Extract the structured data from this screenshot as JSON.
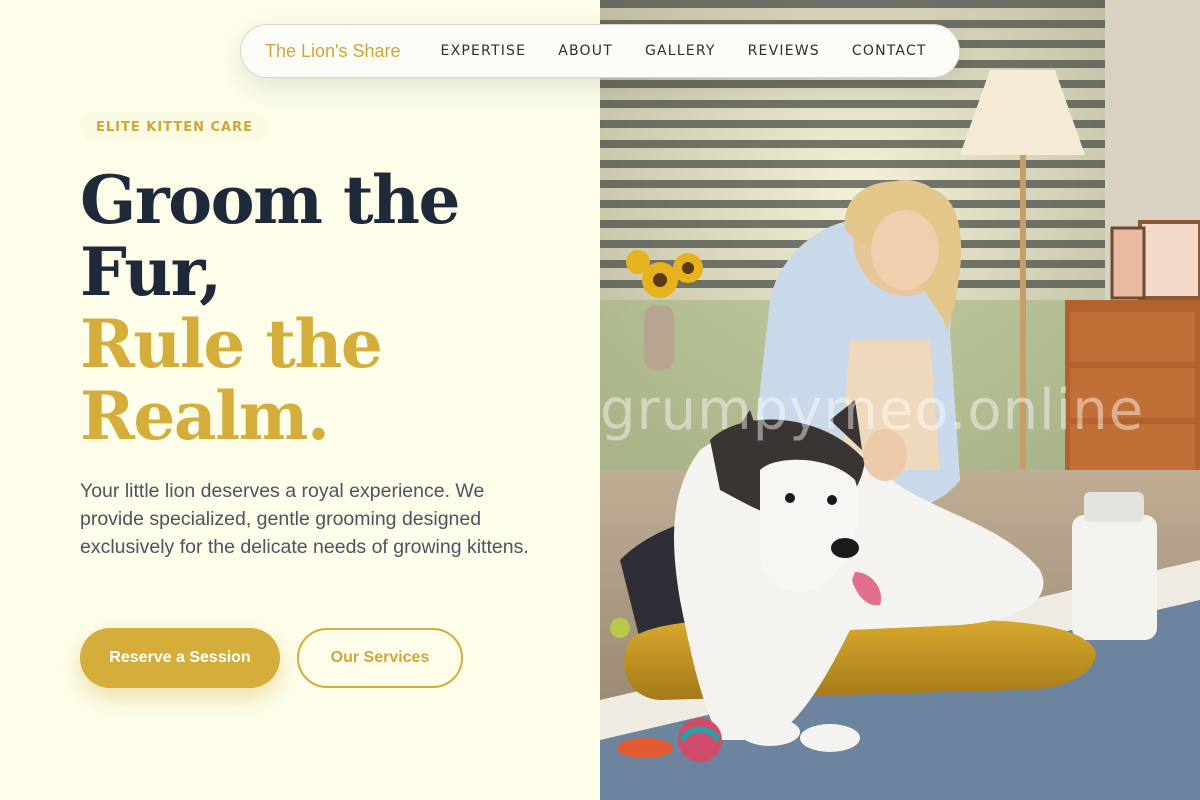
{
  "nav": {
    "brand": "The Lion's Share",
    "links": [
      "EXPERTISE",
      "ABOUT",
      "GALLERY",
      "REVIEWS",
      "CONTACT"
    ]
  },
  "hero": {
    "badge": "ELITE KITTEN CARE",
    "headline_line1": "Groom the",
    "headline_line2": "Fur,",
    "headline_line3": "Rule the",
    "headline_line4": "Realm.",
    "description": "Your little lion deserves a royal experience. We provide specialized, gentle grooming designed exclusively for the delicate needs of growing kittens.",
    "primary_cta": "Reserve a Session",
    "secondary_cta": "Our Services"
  },
  "photo": {
    "watermark": "grumpymeo.online"
  },
  "colors": {
    "accent": "#d4ad3a",
    "heading": "#1e2a3a",
    "background": "#fdfdea"
  }
}
